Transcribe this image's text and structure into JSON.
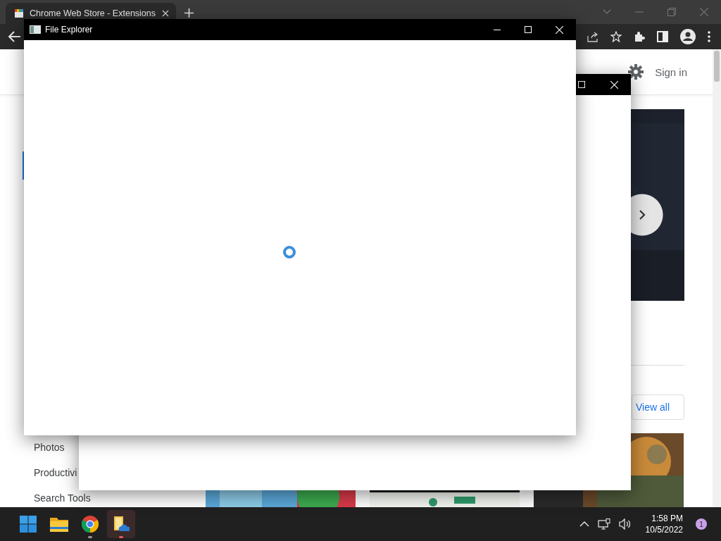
{
  "browser": {
    "tabs": [
      {
        "title": "Chrome Web Store - Extensions",
        "selected": true
      }
    ]
  },
  "store_page": {
    "header": {
      "sign_in": "Sign in"
    },
    "sidebar": {
      "items": [
        {
          "label": "Photos"
        },
        {
          "label": "Productivi"
        },
        {
          "label": "Search Tools"
        }
      ]
    },
    "view_all": "View all"
  },
  "file_explorer": {
    "title": "File Explorer",
    "loading": true
  },
  "taskbar": {
    "apps": [
      {
        "kind": "start",
        "running": false,
        "active": false
      },
      {
        "kind": "folder",
        "running": false,
        "active": false
      },
      {
        "kind": "chrome",
        "running": true,
        "active": false
      },
      {
        "kind": "cloud-folder",
        "running": true,
        "active": true
      }
    ],
    "time": "1:58 PM",
    "date": "10/5/2022",
    "notifications": "1"
  }
}
